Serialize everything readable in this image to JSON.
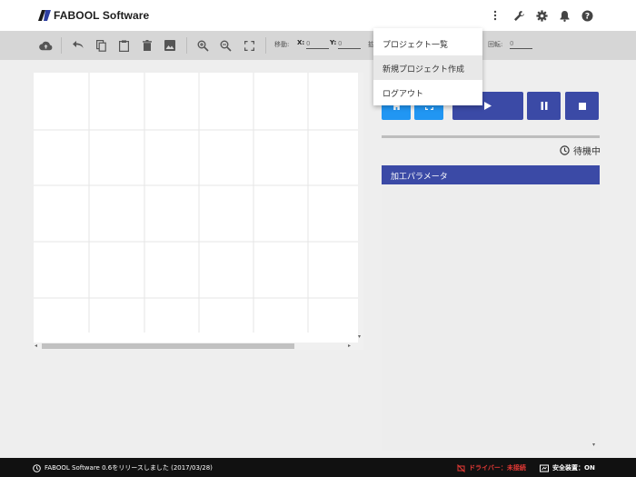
{
  "app": {
    "title": "FABOOL Software"
  },
  "header": {
    "icons": [
      "more-vert-icon",
      "wrench-icon",
      "gear-icon",
      "bell-icon",
      "help-icon"
    ]
  },
  "toolbar": {
    "icons": [
      "cloud-upload-icon",
      "undo-icon",
      "copy-icon",
      "paste-icon",
      "delete-icon",
      "image-icon",
      "zoom-in-icon",
      "zoom-out-icon",
      "fit-screen-icon"
    ],
    "move_label": "移動:",
    "x_label": "X:",
    "x_placeholder": "0",
    "y_label": "Y:",
    "y_placeholder": "0",
    "scale_label": "拡",
    "rotate_label": "回転:",
    "rotate_placeholder": "0"
  },
  "controls": {
    "buttons": [
      "home-icon",
      "frame-icon",
      "play-icon",
      "pause-icon",
      "stop-icon"
    ],
    "accent": "#2196f3",
    "primary": "#3b4aa6"
  },
  "status": {
    "text": "待機中",
    "icon": "clock-icon"
  },
  "params": {
    "title": "加工パラメータ"
  },
  "menu": {
    "items": [
      {
        "label": "プロジェクト一覧"
      },
      {
        "label": "新規プロジェクト作成"
      },
      {
        "label": "ログアウト"
      }
    ]
  },
  "footer": {
    "notice": "FABOOL Software 0.6をリリースしました (2017/03/28)",
    "driver": "ドライバー：未接続",
    "safety": "安全装置：ON",
    "driver_color": "#e53935"
  }
}
